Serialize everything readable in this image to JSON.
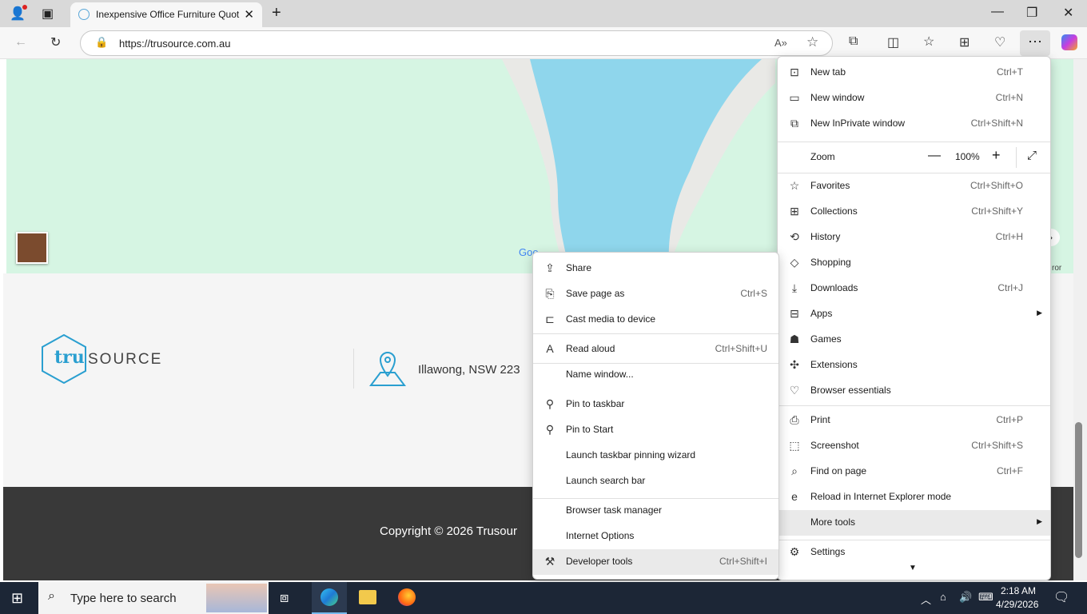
{
  "browser": {
    "tab_title": "Inexpensive Office Furniture Quot",
    "url": "https://trusource.com.au"
  },
  "page": {
    "logo_tru": "tru",
    "logo_source": "SOURCE",
    "address": "Illawong, NSW 223",
    "copyright": "Copyright © 2026 Trusour",
    "map_google": "Goo",
    "map_error": "ror"
  },
  "main_menu": {
    "items": [
      {
        "label": "New tab",
        "shortcut": "Ctrl+T",
        "icon": "new-tab-icon"
      },
      {
        "label": "New window",
        "shortcut": "Ctrl+N",
        "icon": "window-icon"
      },
      {
        "label": "New InPrivate window",
        "shortcut": "Ctrl+Shift+N",
        "icon": "inprivate-icon"
      }
    ],
    "zoom_label": "Zoom",
    "zoom_value": "100%",
    "items2": [
      {
        "label": "Favorites",
        "shortcut": "Ctrl+Shift+O",
        "icon": "star-icon"
      },
      {
        "label": "Collections",
        "shortcut": "Ctrl+Shift+Y",
        "icon": "collections-icon"
      },
      {
        "label": "History",
        "shortcut": "Ctrl+H",
        "icon": "history-icon"
      },
      {
        "label": "Shopping",
        "shortcut": "",
        "icon": "tag-icon"
      },
      {
        "label": "Downloads",
        "shortcut": "Ctrl+J",
        "icon": "download-icon"
      },
      {
        "label": "Apps",
        "shortcut": "",
        "icon": "apps-icon"
      },
      {
        "label": "Games",
        "shortcut": "",
        "icon": "games-icon"
      },
      {
        "label": "Extensions",
        "shortcut": "",
        "icon": "puzzle-icon"
      },
      {
        "label": "Browser essentials",
        "shortcut": "",
        "icon": "heart-pulse-icon"
      }
    ],
    "items3": [
      {
        "label": "Print",
        "shortcut": "Ctrl+P",
        "icon": "printer-icon"
      },
      {
        "label": "Screenshot",
        "shortcut": "Ctrl+Shift+S",
        "icon": "screenshot-icon"
      },
      {
        "label": "Find on page",
        "shortcut": "Ctrl+F",
        "icon": "find-icon"
      },
      {
        "label": "Reload in Internet Explorer mode",
        "shortcut": "",
        "icon": "ie-icon"
      },
      {
        "label": "More tools",
        "shortcut": "",
        "icon": ""
      }
    ],
    "settings": "Settings"
  },
  "sub_menu": {
    "items": [
      {
        "label": "Share",
        "shortcut": "",
        "icon": "share-icon"
      },
      {
        "label": "Save page as",
        "shortcut": "Ctrl+S",
        "icon": "save-icon"
      },
      {
        "label": "Cast media to device",
        "shortcut": "",
        "icon": "cast-icon"
      },
      {
        "label": "Read aloud",
        "shortcut": "Ctrl+Shift+U",
        "icon": "read-aloud-icon"
      },
      {
        "label": "Name window...",
        "shortcut": "",
        "icon": ""
      },
      {
        "label": "Pin to taskbar",
        "shortcut": "",
        "icon": "pin-icon"
      },
      {
        "label": "Pin to Start",
        "shortcut": "",
        "icon": "pin-icon"
      },
      {
        "label": "Launch taskbar pinning wizard",
        "shortcut": "",
        "icon": ""
      },
      {
        "label": "Launch search bar",
        "shortcut": "",
        "icon": ""
      },
      {
        "label": "Browser task manager",
        "shortcut": "",
        "icon": ""
      },
      {
        "label": "Internet Options",
        "shortcut": "",
        "icon": ""
      },
      {
        "label": "Developer tools",
        "shortcut": "Ctrl+Shift+I",
        "icon": "devtools-icon"
      }
    ]
  },
  "taskbar": {
    "search_placeholder": "Type here to search",
    "time": "2:18 AM",
    "date": "4/29/2026"
  },
  "colors": {
    "map_land": "#d6f5e3",
    "map_water": "#8fd6ec",
    "brand": "#2a9fd0",
    "taskbar": "#1c2636"
  }
}
